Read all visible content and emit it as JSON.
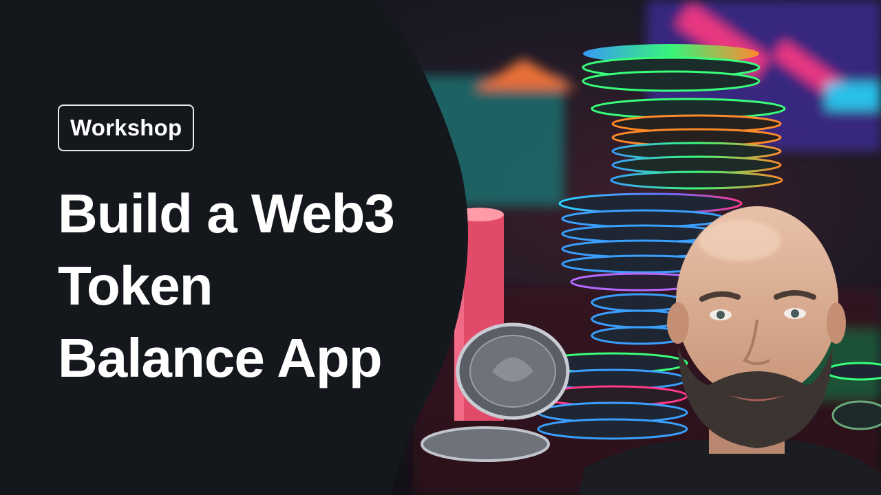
{
  "badge": {
    "label": "Workshop"
  },
  "title": {
    "lines": [
      "Build a Web3",
      "Token",
      "Balance App"
    ]
  },
  "colors": {
    "panel": "#14171c",
    "text": "#ffffff",
    "badge_border": "#e9ecef",
    "neon_green": "#39ff7a",
    "neon_blue": "#3aa0ff",
    "neon_pink": "#ff3a8c",
    "neon_orange": "#ff8a2a"
  }
}
